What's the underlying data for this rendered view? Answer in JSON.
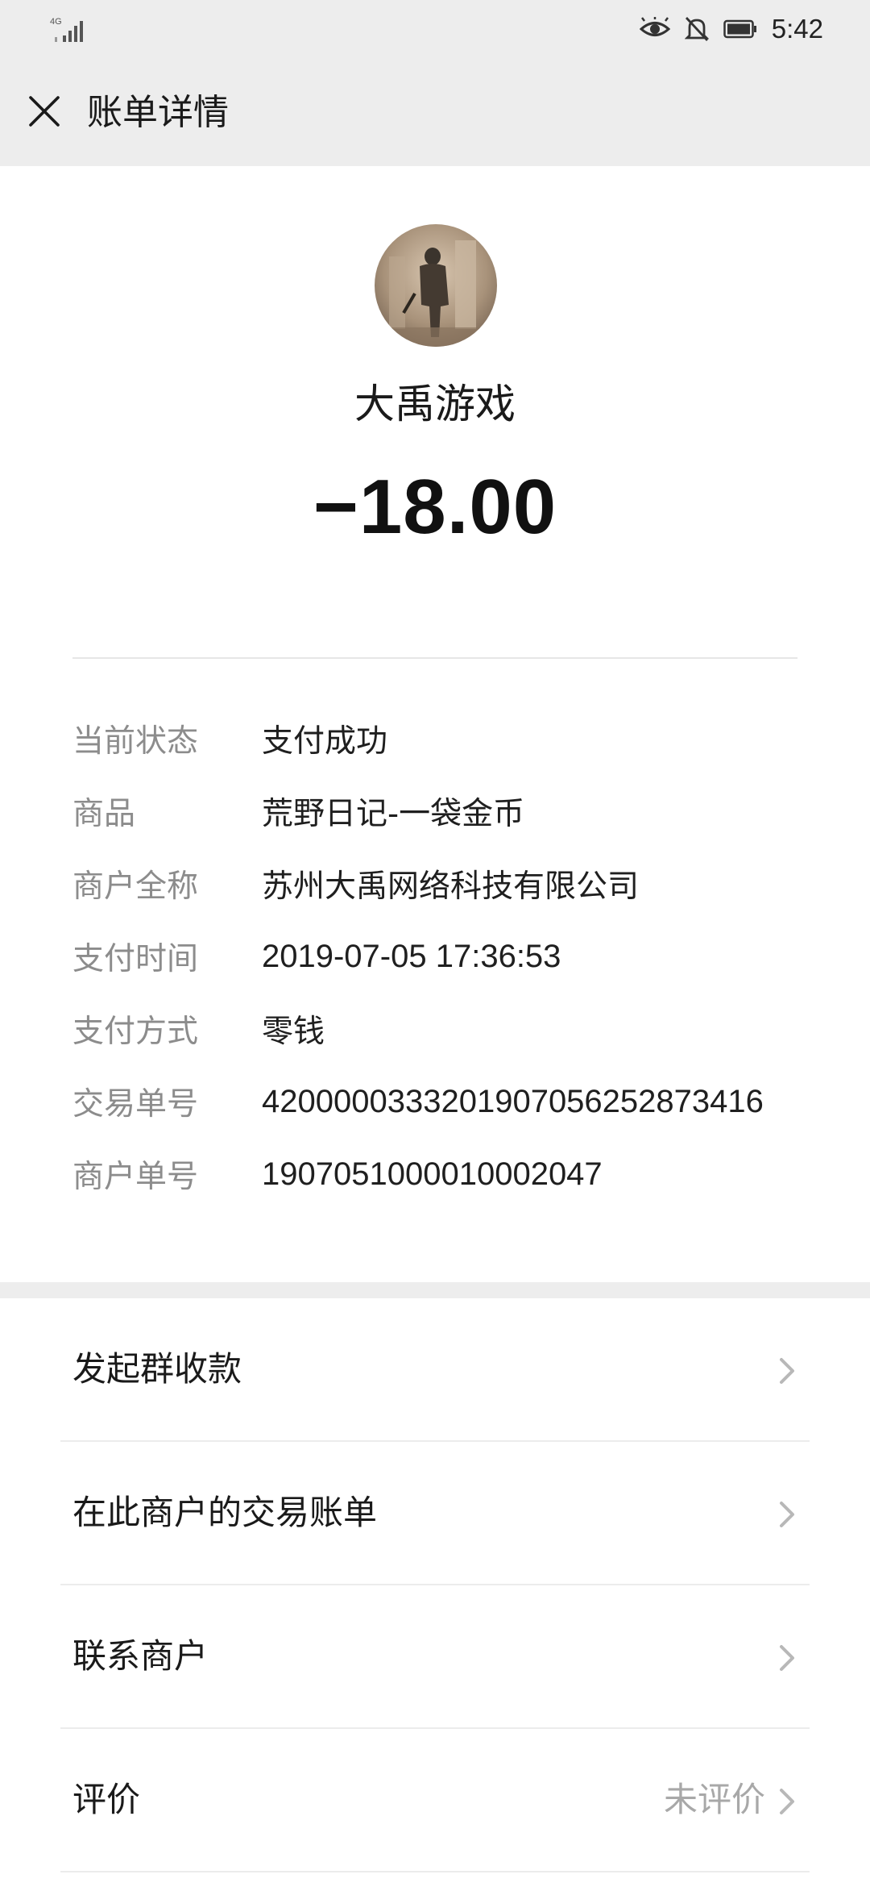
{
  "status_bar": {
    "network": "4G",
    "time": "5:42",
    "icons": [
      "signal-icon",
      "eye-icon",
      "bell-off-icon",
      "battery-icon"
    ]
  },
  "header": {
    "title": "账单详情",
    "close_icon": "close-icon"
  },
  "merchant": {
    "name": "大禹游戏",
    "amount": "−18.00"
  },
  "details": [
    {
      "label": "当前状态",
      "value": "支付成功"
    },
    {
      "label": "商品",
      "value": "荒野日记-一袋金币"
    },
    {
      "label": "商户全称",
      "value": "苏州大禹网络科技有限公司"
    },
    {
      "label": "支付时间",
      "value": "2019-07-05 17:36:53"
    },
    {
      "label": "支付方式",
      "value": "零钱"
    },
    {
      "label": "交易单号",
      "value": "4200000333201907056252873416"
    },
    {
      "label": "商户单号",
      "value": "1907051000010002047"
    }
  ],
  "actions": [
    {
      "label": "发起群收款",
      "value": ""
    },
    {
      "label": "在此商户的交易账单",
      "value": ""
    },
    {
      "label": "联系商户",
      "value": ""
    },
    {
      "label": "评价",
      "value": "未评价"
    }
  ]
}
